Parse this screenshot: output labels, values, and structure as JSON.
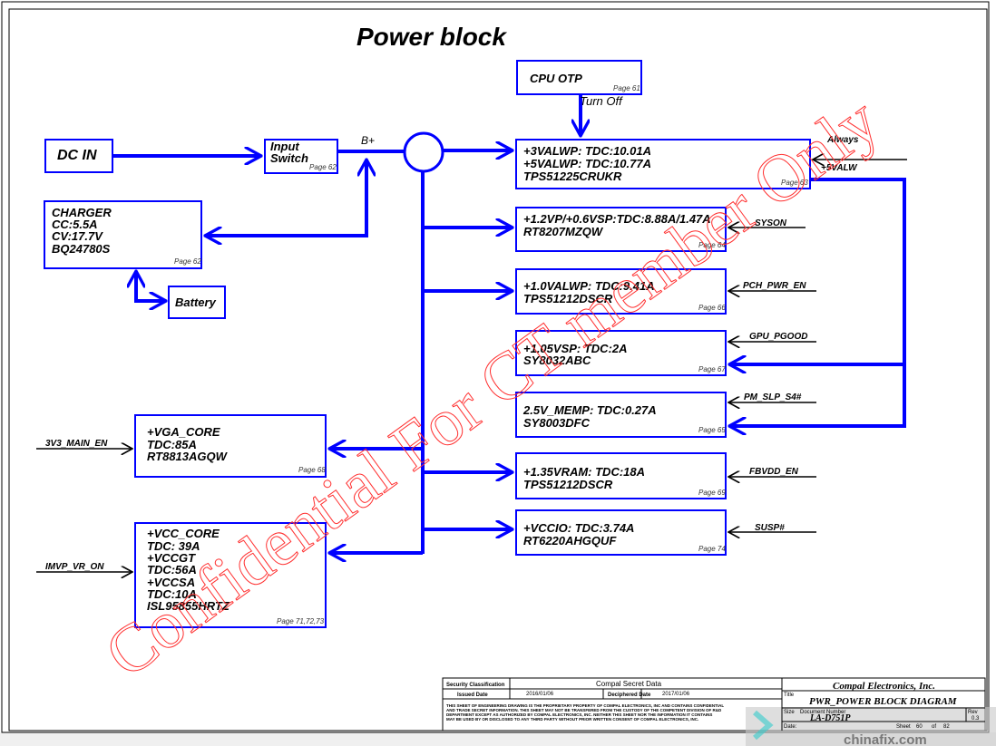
{
  "title": "Power block",
  "colors": {
    "bus": "#0000ff",
    "watermark": "#ff3030",
    "signal": "#000000"
  },
  "blocks": {
    "cpu_otp": {
      "lines": [
        "CPU OTP"
      ],
      "page": "Page 61"
    },
    "dc_in": {
      "lines": [
        "DC IN"
      ]
    },
    "input_switch": {
      "lines": [
        "Input",
        "Switch"
      ],
      "page": "Page 62"
    },
    "charger": {
      "lines": [
        "CHARGER",
        "CC:5.5A",
        "CV:17.7V",
        "BQ24780S"
      ],
      "page": "Page 62"
    },
    "battery": {
      "lines": [
        "Battery"
      ]
    },
    "valwp": {
      "lines": [
        "+3VALWP:  TDC:10.01A",
        "+5VALWP:  TDC:10.77A",
        "TPS51225CRUKR"
      ],
      "page": "Page 63"
    },
    "vp12": {
      "lines": [
        "+1.2VP/+0.6VSP:TDC:8.88A/1.47A",
        "RT8207MZQW"
      ],
      "page": "Page 64"
    },
    "valwp10": {
      "lines": [
        "+1.0VALWP:  TDC:9.41A",
        "TPS51212DSCR"
      ],
      "page": "Page 66"
    },
    "vsp105": {
      "lines": [
        "+1.05VSP:  TDC:2A",
        "SY8032ABC"
      ],
      "page": "Page 67"
    },
    "memp25": {
      "lines": [
        "2.5V_MEMP:  TDC:0.27A",
        "SY8003DFC"
      ],
      "page": "Page 65"
    },
    "vram135": {
      "lines": [
        "+1.35VRAM:  TDC:18A",
        "TPS51212DSCR"
      ],
      "page": "Page 69"
    },
    "vccio": {
      "lines": [
        "+VCCIO:  TDC:3.74A",
        "RT6220AHGQUF"
      ],
      "page": "Page 74"
    },
    "vga_core": {
      "lines": [
        "+VGA_CORE",
        "TDC:85A",
        "RT8813AGQW"
      ],
      "page": "Page 68"
    },
    "vcc_core": {
      "lines": [
        "+VCC_CORE",
        "TDC: 39A",
        "+VCCGT",
        "TDC:56A",
        "+VCCSA",
        "TDC:10A",
        "ISL95855HRTZ"
      ],
      "page": "Page 71,72,73"
    }
  },
  "labels": {
    "turn_off": "Turn Off",
    "b_plus": "B+",
    "always": "Always",
    "v5alw": "+5VALW"
  },
  "signals": [
    "SYSON",
    "PCH_PWR_EN",
    "GPU_PGOOD",
    "PM_SLP_S4#",
    "FBVDD_EN",
    "SUSP#",
    "3V3_MAIN_EN",
    "IMVP_VR_ON"
  ],
  "watermark": "Confidential For CT member Only",
  "title_block": {
    "security_label": "Security Classification",
    "security_value": "Compal Secret Data",
    "issued_label": "Issued Date",
    "issued_value": "2016/01/06",
    "deciphered_label": "Deciphered Date",
    "deciphered_value": "2017/01/06",
    "notice": [
      "THIS SHEET OF ENGINEERING DRAWING IS THE PROPRIETARY PROPERTY OF COMPAL ELECTRONICS, INC AND CONTAINS CONFIDENTIAL",
      "AND TRADE SECRET INFORMATION. THIS SHEET MAY NOT BE TRANSFERED FROM THE CUSTODY OF THE COMPETENT DIVISION OF R&D",
      "DEPARTMENT EXCEPT AS AUTHORIZED BY COMPAL ELECTRONICS, INC. NEITHER THIS SHEET NOR THE INFORMATION IT CONTAINS",
      "MAY BE USED BY OR DISCLOSED TO ANY THIRD PARTY WITHOUT PRIOR WRITTEN CONSENT OF COMPAL ELECTRONICS, INC."
    ],
    "company": "Compal Electronics, Inc.",
    "title_label": "Title",
    "sheet_title": "PWR_POWER BLOCK DIAGRAM",
    "size_label": "Size",
    "doc_label": "Document Number",
    "doc_number": "LA-D751P",
    "rev_label": "Rev",
    "rev": "0.3",
    "date_label": "Date:",
    "sheet_label": "Sheet",
    "sheet_no": "60",
    "of_label": "of",
    "sheet_total": "82"
  },
  "overlay": "chinafix.com"
}
